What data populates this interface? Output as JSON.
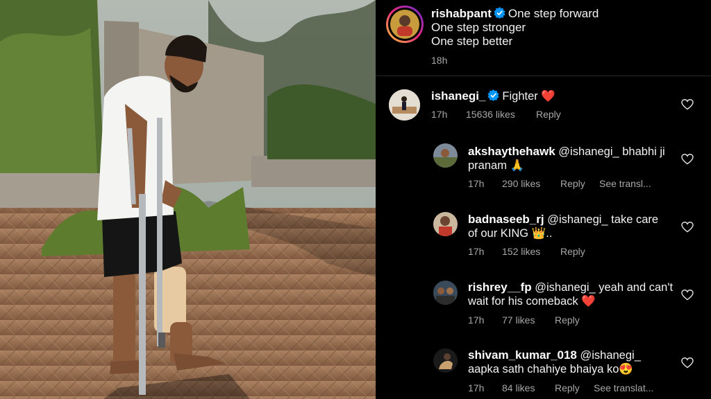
{
  "post": {
    "username": "rishabpant",
    "caption_line1": "One step forward",
    "caption_line2": "One step stronger",
    "caption_line3": "One step better",
    "time": "18h"
  },
  "comments": [
    {
      "username": "ishanegi_",
      "text": "Fighter ❤️",
      "time": "17h",
      "likes": "15636 likes",
      "reply": "Reply"
    },
    {
      "username": "akshaythehawk",
      "mention": "@ishanegi_",
      "text": " bhabhi ji",
      "text2": "pranam 🙏",
      "time": "17h",
      "likes": "290 likes",
      "reply": "Reply",
      "translate": "See transl..."
    },
    {
      "username": "badnaseeb_rj",
      "mention": "@ishanegi_",
      "text": " take care",
      "text2": "of our KING 👑..",
      "time": "17h",
      "likes": "152 likes",
      "reply": "Reply"
    },
    {
      "username": "rishrey__fp",
      "mention": "@ishanegi_",
      "text": " yeah and can't",
      "text2": "wait for his comeback ❤️",
      "time": "17h",
      "likes": "77 likes",
      "reply": "Reply"
    },
    {
      "username": "shivam_kumar_018",
      "mention": "@ishanegi_",
      "text": "",
      "text2": "aapka sath chahiye bhaiya ko😍",
      "time": "17h",
      "likes": "84 likes",
      "reply": "Reply",
      "translate": "See translat..."
    }
  ],
  "icons": {
    "verified": "verified-badge-icon",
    "like": "heart-outline-icon"
  },
  "colors": {
    "verified": "#0095f6",
    "secondary_text": "#a8a8a8"
  }
}
